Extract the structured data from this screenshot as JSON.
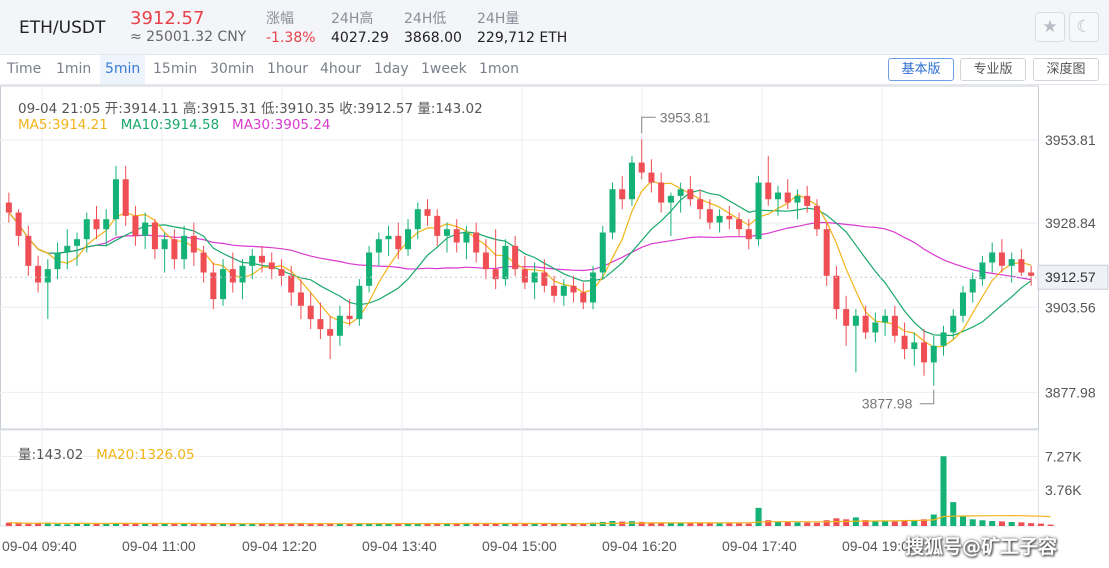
{
  "header": {
    "pair": "ETH/USDT",
    "price": "3912.57",
    "price_cny": "≈ 25001.32 CNY",
    "stats": [
      {
        "label": "涨幅",
        "value": "-1.38%",
        "red": true
      },
      {
        "label": "24H高",
        "value": "4027.29"
      },
      {
        "label": "24H低",
        "value": "3868.00"
      },
      {
        "label": "24H量",
        "value": "229,712 ETH"
      }
    ],
    "favorite_icon": "star-icon",
    "theme_icon": "moon-icon"
  },
  "toolbar": {
    "timeframes": [
      "Time",
      "1min",
      "5min",
      "15min",
      "30min",
      "1hour",
      "4hour",
      "1day",
      "1week",
      "1mon"
    ],
    "active_timeframe": "5min",
    "views": [
      "基本版",
      "专业版",
      "深度图"
    ],
    "active_view": "基本版"
  },
  "info": {
    "ohlc": "09-04 21:05  开:3914.11  高:3915.31  低:3910.35  收:3912.57  量:143.02",
    "ma5": "MA5:3914.21",
    "ma10": "MA10:3914.58",
    "ma30": "MA30:3905.24",
    "vol": "量:143.02",
    "ma20": "MA20:1326.05"
  },
  "colors": {
    "up": "#14b277",
    "down": "#ef4e55",
    "ma5": "#f2b418",
    "ma10": "#18a86a",
    "ma30": "#d93ad0",
    "grid": "#eceef1",
    "axis_text": "#555"
  },
  "watermark": "搜狐号@矿工子容",
  "chart_data": {
    "type": "candlestick",
    "interval": "5min",
    "x_tick_labels": [
      "09-04 09:40",
      "09-04 11:00",
      "09-04 12:20",
      "09-04 13:40",
      "09-04 15:00",
      "09-04 16:20",
      "09-04 17:40",
      "09-04 19:00"
    ],
    "price_axis_labels": [
      "3953.81",
      "3928.84",
      "3903.56",
      "3877.98"
    ],
    "current_price_label": "3912.57",
    "volume_axis_labels": [
      "7.27K",
      "3.76K"
    ],
    "max_annotation": "3953.81",
    "min_annotation": "3877.98",
    "price_range": [
      3867,
      3970
    ],
    "volume_range": [
      0,
      9000
    ],
    "candles_ohlc": [
      [
        3935,
        3938,
        3929,
        3932
      ],
      [
        3932,
        3933,
        3922,
        3925
      ],
      [
        3925,
        3928,
        3913,
        3916
      ],
      [
        3916,
        3919,
        3908,
        3911
      ],
      [
        3911,
        3918,
        3900,
        3915
      ],
      [
        3915,
        3923,
        3912,
        3920
      ],
      [
        3920,
        3927,
        3915,
        3922
      ],
      [
        3922,
        3926,
        3916,
        3924
      ],
      [
        3924,
        3932,
        3920,
        3930
      ],
      [
        3930,
        3934,
        3924,
        3927
      ],
      [
        3927,
        3933,
        3922,
        3930
      ],
      [
        3930,
        3946,
        3925,
        3942
      ],
      [
        3942,
        3946,
        3928,
        3931
      ],
      [
        3931,
        3934,
        3922,
        3925
      ],
      [
        3925,
        3932,
        3921,
        3929
      ],
      [
        3929,
        3930,
        3918,
        3921
      ],
      [
        3921,
        3926,
        3914,
        3924
      ],
      [
        3924,
        3927,
        3915,
        3918
      ],
      [
        3918,
        3928,
        3915,
        3925
      ],
      [
        3925,
        3929,
        3916,
        3920
      ],
      [
        3920,
        3922,
        3911,
        3914
      ],
      [
        3914,
        3917,
        3903,
        3906
      ],
      [
        3906,
        3918,
        3904,
        3915
      ],
      [
        3915,
        3920,
        3908,
        3911
      ],
      [
        3911,
        3918,
        3906,
        3916
      ],
      [
        3916,
        3921,
        3912,
        3919
      ],
      [
        3919,
        3922,
        3914,
        3917
      ],
      [
        3917,
        3920,
        3912,
        3915
      ],
      [
        3915,
        3918,
        3910,
        3913
      ],
      [
        3913,
        3916,
        3904,
        3908
      ],
      [
        3908,
        3912,
        3900,
        3904
      ],
      [
        3904,
        3908,
        3897,
        3900
      ],
      [
        3900,
        3905,
        3894,
        3897
      ],
      [
        3897,
        3901,
        3888,
        3895
      ],
      [
        3895,
        3904,
        3892,
        3901
      ],
      [
        3901,
        3906,
        3898,
        3900
      ],
      [
        3900,
        3912,
        3898,
        3910
      ],
      [
        3910,
        3922,
        3908,
        3920
      ],
      [
        3920,
        3926,
        3916,
        3924
      ],
      [
        3924,
        3928,
        3919,
        3925
      ],
      [
        3925,
        3929,
        3918,
        3921
      ],
      [
        3921,
        3930,
        3919,
        3927
      ],
      [
        3927,
        3935,
        3924,
        3933
      ],
      [
        3933,
        3936,
        3928,
        3931
      ],
      [
        3931,
        3933,
        3922,
        3925
      ],
      [
        3925,
        3929,
        3920,
        3927
      ],
      [
        3927,
        3930,
        3920,
        3923
      ],
      [
        3923,
        3928,
        3918,
        3926
      ],
      [
        3926,
        3929,
        3917,
        3920
      ],
      [
        3920,
        3924,
        3912,
        3915
      ],
      [
        3915,
        3927,
        3909,
        3912
      ],
      [
        3912,
        3924,
        3910,
        3922
      ],
      [
        3922,
        3925,
        3913,
        3915
      ],
      [
        3915,
        3919,
        3909,
        3911
      ],
      [
        3911,
        3917,
        3906,
        3914
      ],
      [
        3914,
        3918,
        3908,
        3910
      ],
      [
        3910,
        3913,
        3905,
        3907
      ],
      [
        3907,
        3912,
        3904,
        3910
      ],
      [
        3910,
        3913,
        3905,
        3908
      ],
      [
        3908,
        3911,
        3903,
        3905
      ],
      [
        3905,
        3916,
        3903,
        3914
      ],
      [
        3914,
        3928,
        3912,
        3926
      ],
      [
        3926,
        3941,
        3924,
        3939
      ],
      [
        3939,
        3943,
        3933,
        3936
      ],
      [
        3936,
        3949,
        3934,
        3947
      ],
      [
        3947,
        3954,
        3942,
        3944
      ],
      [
        3944,
        3948,
        3938,
        3941
      ],
      [
        3941,
        3944,
        3932,
        3935
      ],
      [
        3935,
        3938,
        3925,
        3937
      ],
      [
        3937,
        3941,
        3932,
        3939
      ],
      [
        3939,
        3943,
        3934,
        3936
      ],
      [
        3936,
        3939,
        3930,
        3933
      ],
      [
        3933,
        3936,
        3927,
        3929
      ],
      [
        3929,
        3933,
        3926,
        3931
      ],
      [
        3931,
        3934,
        3927,
        3930
      ],
      [
        3930,
        3932,
        3925,
        3927
      ],
      [
        3927,
        3930,
        3921,
        3924
      ],
      [
        3924,
        3943,
        3922,
        3941
      ],
      [
        3941,
        3949,
        3934,
        3936
      ],
      [
        3936,
        3940,
        3931,
        3938
      ],
      [
        3938,
        3942,
        3933,
        3935
      ],
      [
        3935,
        3939,
        3930,
        3937
      ],
      [
        3937,
        3940,
        3932,
        3934
      ],
      [
        3934,
        3936,
        3925,
        3927
      ],
      [
        3927,
        3929,
        3910,
        3913
      ],
      [
        3913,
        3916,
        3900,
        3903
      ],
      [
        3903,
        3907,
        3892,
        3898
      ],
      [
        3898,
        3903,
        3884,
        3901
      ],
      [
        3901,
        3904,
        3894,
        3896
      ],
      [
        3896,
        3902,
        3893,
        3899
      ],
      [
        3899,
        3903,
        3895,
        3901
      ],
      [
        3901,
        3904,
        3893,
        3895
      ],
      [
        3895,
        3899,
        3888,
        3891
      ],
      [
        3891,
        3896,
        3886,
        3893
      ],
      [
        3893,
        3897,
        3883,
        3887
      ],
      [
        3887,
        3895,
        3880,
        3892
      ],
      [
        3892,
        3898,
        3889,
        3896
      ],
      [
        3896,
        3903,
        3894,
        3901
      ],
      [
        3901,
        3910,
        3899,
        3908
      ],
      [
        3908,
        3914,
        3905,
        3912
      ],
      [
        3912,
        3919,
        3910,
        3917
      ],
      [
        3917,
        3923,
        3914,
        3920
      ],
      [
        3920,
        3924,
        3914,
        3916
      ],
      [
        3916,
        3920,
        3911,
        3918
      ],
      [
        3918,
        3921,
        3913,
        3914
      ],
      [
        3914,
        3916,
        3910,
        3913
      ]
    ],
    "volumes": [
      350,
      280,
      240,
      300,
      330,
      220,
      180,
      250,
      270,
      210,
      260,
      320,
      300,
      250,
      230,
      240,
      220,
      260,
      250,
      200,
      230,
      260,
      240,
      220,
      210,
      230,
      250,
      200,
      220,
      260,
      300,
      280,
      240,
      260,
      230,
      250,
      300,
      280,
      260,
      240,
      230,
      260,
      290,
      270,
      250,
      240,
      220,
      260,
      230,
      250,
      310,
      290,
      260,
      240,
      220,
      250,
      230,
      260,
      240,
      220,
      350,
      420,
      520,
      460,
      500,
      430,
      380,
      360,
      340,
      320,
      300,
      280,
      260,
      280,
      300,
      270,
      250,
      1900,
      600,
      450,
      420,
      380,
      360,
      340,
      600,
      800,
      700,
      900,
      620,
      540,
      500,
      480,
      600,
      520,
      700,
      1200,
      7300,
      2500,
      1000,
      700,
      600,
      520,
      480,
      420,
      380,
      300,
      250,
      143
    ]
  }
}
